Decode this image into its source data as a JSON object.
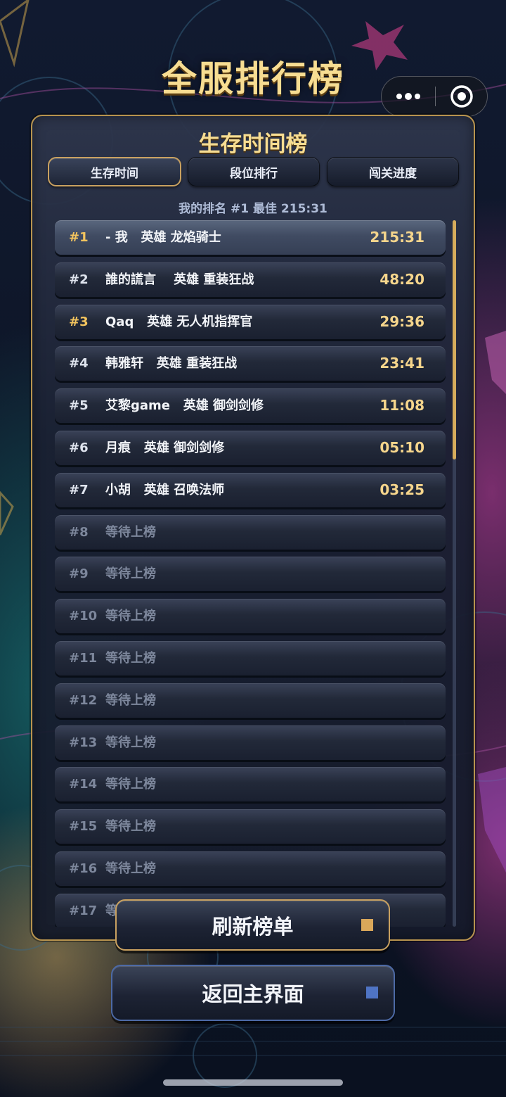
{
  "page_title": "全服排行榜",
  "panel": {
    "title": "生存时间榜",
    "tabs": [
      {
        "label": "生存时间",
        "active": true
      },
      {
        "label": "段位排行",
        "active": false
      },
      {
        "label": "闯关进度",
        "active": false
      }
    ],
    "my_rank": "我的排名 #1  最佳 215:31"
  },
  "leaderboard": [
    {
      "rank": "#1",
      "name": "- 我   英雄 龙焰骑士",
      "time": "215:31",
      "me": true,
      "gold": true
    },
    {
      "rank": "#2",
      "name": "誰的謊言    英雄 重装狂战",
      "time": "48:20"
    },
    {
      "rank": "#3",
      "name": "Qaq   英雄 无人机指挥官",
      "time": "29:36",
      "gold": true
    },
    {
      "rank": "#4",
      "name": "韩雅轩   英雄 重装狂战",
      "time": "23:41"
    },
    {
      "rank": "#5",
      "name": "艾黎game   英雄 御剑剑修",
      "time": "11:08"
    },
    {
      "rank": "#6",
      "name": "月痕   英雄 御剑剑修",
      "time": "05:10"
    },
    {
      "rank": "#7",
      "name": "小胡   英雄 召唤法师",
      "time": "03:25"
    },
    {
      "rank": "#8",
      "name": "等待上榜",
      "time": "",
      "empty": true
    },
    {
      "rank": "#9",
      "name": "等待上榜",
      "time": "",
      "empty": true
    },
    {
      "rank": "#10",
      "name": "等待上榜",
      "time": "",
      "empty": true
    },
    {
      "rank": "#11",
      "name": "等待上榜",
      "time": "",
      "empty": true
    },
    {
      "rank": "#12",
      "name": "等待上榜",
      "time": "",
      "empty": true
    },
    {
      "rank": "#13",
      "name": "等待上榜",
      "time": "",
      "empty": true
    },
    {
      "rank": "#14",
      "name": "等待上榜",
      "time": "",
      "empty": true
    },
    {
      "rank": "#15",
      "name": "等待上榜",
      "time": "",
      "empty": true
    },
    {
      "rank": "#16",
      "name": "等待上榜",
      "time": "",
      "empty": true
    },
    {
      "rank": "#17",
      "name": "等待上榜",
      "time": "",
      "empty": true
    }
  ],
  "buttons": {
    "refresh": "刷新榜单",
    "back": "返回主界面"
  },
  "capsule": {
    "more_icon": "more-dots-icon",
    "close_icon": "target-circle-icon"
  },
  "colors": {
    "gold_text": "#f7dd92",
    "gold_border": "#c9a160",
    "rank_gold": "#f3c45e",
    "time_color": "#f5d58c",
    "back_accent": "#4f74c4"
  }
}
